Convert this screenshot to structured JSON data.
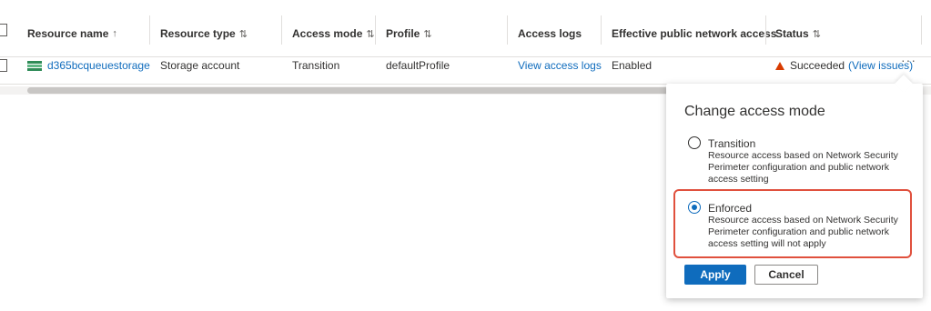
{
  "table": {
    "headers": [
      {
        "label": "Resource name",
        "sort": "↑"
      },
      {
        "label": "Resource type",
        "sort": "⇅"
      },
      {
        "label": "Access mode",
        "sort": "⇅"
      },
      {
        "label": "Profile",
        "sort": "⇅"
      },
      {
        "label": "Access logs",
        "sort": ""
      },
      {
        "label": "Effective public network access",
        "sort": ""
      },
      {
        "label": "Status",
        "sort": "⇅"
      }
    ],
    "row": {
      "resource_name": "d365bcqueuestorage",
      "resource_type": "Storage account",
      "access_mode": "Transition",
      "profile": "defaultProfile",
      "access_logs": "View access logs",
      "public_access": "Enabled",
      "status": "Succeeded",
      "status_link": "(View issues)",
      "more": "···"
    }
  },
  "popup": {
    "title": "Change access mode",
    "options": [
      {
        "label": "Transition",
        "description": "Resource access based on Network Security Perimeter configuration and public network access setting",
        "selected": false
      },
      {
        "label": "Enforced",
        "description": "Resource access based on Network Security Perimeter configuration and public network access setting will not apply",
        "selected": true
      }
    ],
    "apply_label": "Apply",
    "cancel_label": "Cancel"
  },
  "colors": {
    "accent": "#0f6cbd",
    "warning": "#d83b01",
    "highlight": "#e0503d",
    "storage_icon": "#2e8b57"
  }
}
